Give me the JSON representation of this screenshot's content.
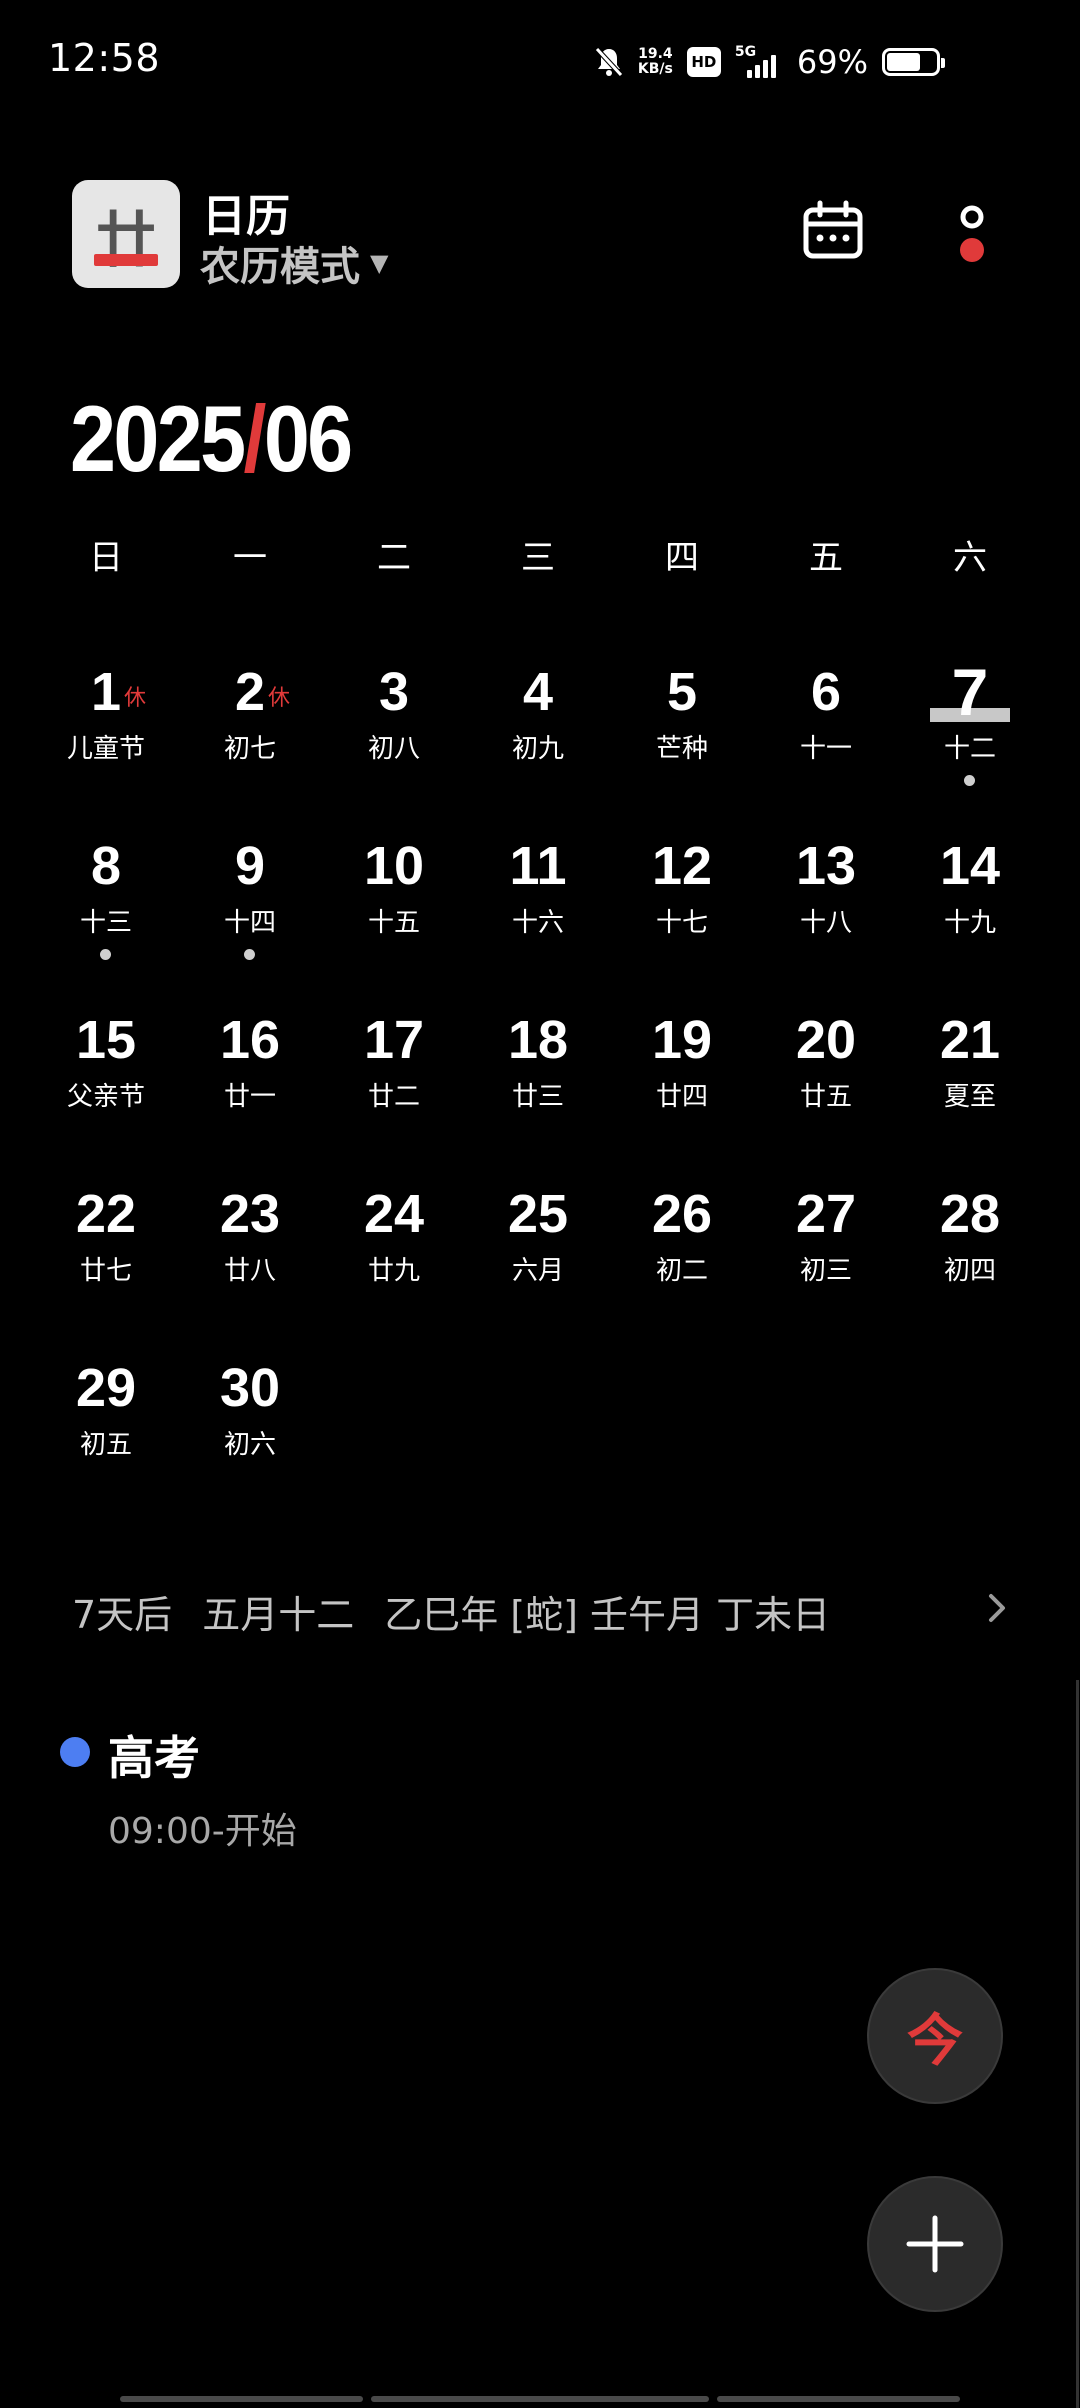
{
  "status_bar": {
    "time": "12:58",
    "net_speed_value": "19.4",
    "net_speed_unit": "KB/s",
    "hd": "HD",
    "network": "5G",
    "battery": "69%"
  },
  "header": {
    "logo_glyph": "廿",
    "title": "日历",
    "mode": "农历模式",
    "mode_caret": "▼"
  },
  "month": {
    "year": "2025",
    "sep": "/",
    "month": "06"
  },
  "weekdays": [
    "日",
    "一",
    "二",
    "三",
    "四",
    "五",
    "六"
  ],
  "days": [
    {
      "num": "1",
      "sub": "儿童节",
      "tag": "休"
    },
    {
      "num": "2",
      "sub": "初七",
      "tag": "休"
    },
    {
      "num": "3",
      "sub": "初八"
    },
    {
      "num": "4",
      "sub": "初九"
    },
    {
      "num": "5",
      "sub": "芒种"
    },
    {
      "num": "6",
      "sub": "十一"
    },
    {
      "num": "7",
      "sub": "十二",
      "today": true,
      "dot": true
    },
    {
      "num": "8",
      "sub": "十三",
      "dot": true
    },
    {
      "num": "9",
      "sub": "十四",
      "dot": true
    },
    {
      "num": "10",
      "sub": "十五"
    },
    {
      "num": "11",
      "sub": "十六"
    },
    {
      "num": "12",
      "sub": "十七"
    },
    {
      "num": "13",
      "sub": "十八"
    },
    {
      "num": "14",
      "sub": "十九"
    },
    {
      "num": "15",
      "sub": "父亲节"
    },
    {
      "num": "16",
      "sub": "廿一"
    },
    {
      "num": "17",
      "sub": "廿二"
    },
    {
      "num": "18",
      "sub": "廿三"
    },
    {
      "num": "19",
      "sub": "廿四"
    },
    {
      "num": "20",
      "sub": "廿五"
    },
    {
      "num": "21",
      "sub": "夏至"
    },
    {
      "num": "22",
      "sub": "廿七"
    },
    {
      "num": "23",
      "sub": "廿八"
    },
    {
      "num": "24",
      "sub": "廿九"
    },
    {
      "num": "25",
      "sub": "六月"
    },
    {
      "num": "26",
      "sub": "初二"
    },
    {
      "num": "27",
      "sub": "初三"
    },
    {
      "num": "28",
      "sub": "初四"
    },
    {
      "num": "29",
      "sub": "初五"
    },
    {
      "num": "30",
      "sub": "初六"
    }
  ],
  "info": {
    "relative": "7天后",
    "lunar_date": "五月十二",
    "ganzhi": "乙巳年 [蛇] 壬午月 丁未日"
  },
  "event": {
    "title": "高考",
    "time": "09:00-开始",
    "color": "#4d7ef2"
  },
  "fab": {
    "today_label": "今",
    "add_label": "+"
  },
  "colors": {
    "accent_red": "#e03a3a",
    "background": "#000000"
  },
  "icons": {
    "calendar": "calendar-icon",
    "more": "more-vertical-icon",
    "chevron": "chevron-right-icon",
    "add": "plus-icon"
  }
}
